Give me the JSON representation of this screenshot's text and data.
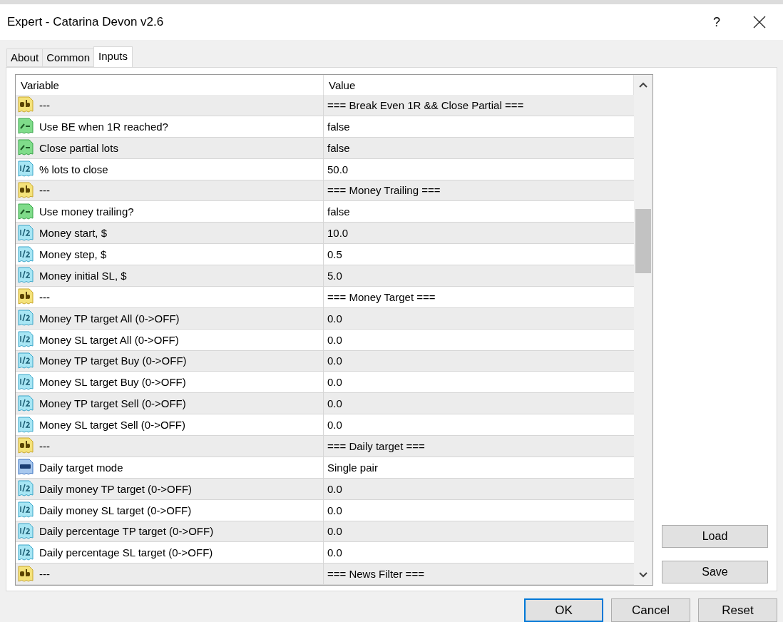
{
  "window": {
    "title": "Expert - Catarina Devon v2.6",
    "help": "?"
  },
  "tabs": [
    {
      "label": "About",
      "selected": false
    },
    {
      "label": "Common",
      "selected": false
    },
    {
      "label": "Inputs",
      "selected": true
    }
  ],
  "table": {
    "columns": [
      "Variable",
      "Value"
    ],
    "rows": [
      {
        "kind": "text",
        "variable": "---",
        "value": "=== Break Even 1R && Close Partial ==="
      },
      {
        "kind": "bool",
        "variable": "Use BE when 1R reached?",
        "value": "false"
      },
      {
        "kind": "bool",
        "variable": "Close partial lots",
        "value": "false"
      },
      {
        "kind": "number",
        "variable": "% lots to close",
        "value": "50.0"
      },
      {
        "kind": "text",
        "variable": "---",
        "value": "=== Money Trailing ==="
      },
      {
        "kind": "bool",
        "variable": "Use money trailing?",
        "value": "false"
      },
      {
        "kind": "number",
        "variable": "Money start, $",
        "value": "10.0"
      },
      {
        "kind": "number",
        "variable": "Money step, $",
        "value": "0.5"
      },
      {
        "kind": "number",
        "variable": "Money initial SL, $",
        "value": "5.0"
      },
      {
        "kind": "text",
        "variable": "---",
        "value": "=== Money Target ==="
      },
      {
        "kind": "number",
        "variable": "Money TP target All (0->OFF)",
        "value": "0.0"
      },
      {
        "kind": "number",
        "variable": "Money SL target All (0->OFF)",
        "value": "0.0"
      },
      {
        "kind": "number",
        "variable": "Money TP target Buy (0->OFF)",
        "value": "0.0"
      },
      {
        "kind": "number",
        "variable": "Money SL target Buy (0->OFF)",
        "value": "0.0"
      },
      {
        "kind": "number",
        "variable": "Money TP target Sell (0->OFF)",
        "value": "0.0"
      },
      {
        "kind": "number",
        "variable": "Money SL target Sell (0->OFF)",
        "value": "0.0"
      },
      {
        "kind": "text",
        "variable": "---",
        "value": "=== Daily target ==="
      },
      {
        "kind": "enum",
        "variable": "Daily target mode",
        "value": "Single pair"
      },
      {
        "kind": "number",
        "variable": "Daily money TP target (0->OFF)",
        "value": "0.0"
      },
      {
        "kind": "number",
        "variable": "Daily money SL target (0->OFF)",
        "value": "0.0"
      },
      {
        "kind": "number",
        "variable": "Daily percentage TP target (0->OFF)",
        "value": "0.0"
      },
      {
        "kind": "number",
        "variable": "Daily percentage SL target (0->OFF)",
        "value": "0.0"
      },
      {
        "kind": "text",
        "variable": "---",
        "value": "=== News Filter ==="
      }
    ]
  },
  "side_buttons": [
    "Load",
    "Save"
  ],
  "footer_buttons": [
    {
      "label": "OK",
      "default": true
    },
    {
      "label": "Cancel",
      "default": false
    },
    {
      "label": "Reset",
      "default": false
    }
  ]
}
